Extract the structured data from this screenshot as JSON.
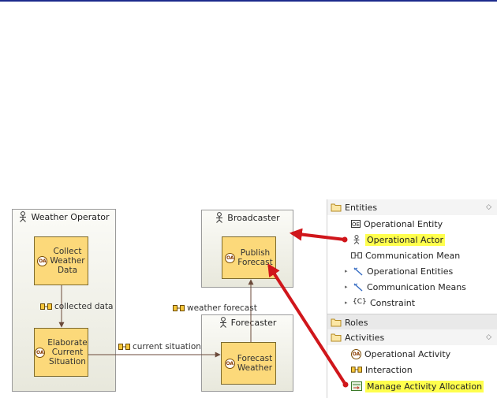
{
  "diagram": {
    "actors": [
      {
        "label": "Weather Operator"
      },
      {
        "label": "Broadcaster"
      },
      {
        "label": "Forecaster"
      }
    ],
    "activities": [
      {
        "label": "Collect Weather Data",
        "line1": "Collect",
        "line2": "Weather",
        "line3": "Data"
      },
      {
        "label": "Elaborate Current Situation",
        "line1": "Elaborate",
        "line2": "Current",
        "line3": "Situation"
      },
      {
        "label": "Publish Forecast",
        "line1": "Publish",
        "line2": "Forecast"
      },
      {
        "label": "Forecast Weather",
        "line1": "Forecast",
        "line2": "Weather"
      }
    ],
    "oa_badge": "OA",
    "interactions": [
      {
        "label": "collected data"
      },
      {
        "label": "current situation"
      },
      {
        "label": "weather forecast"
      }
    ]
  },
  "palette": {
    "entities_header": "Entities",
    "items": [
      {
        "label": "Operational Entity",
        "icon": "operational-entity-icon"
      },
      {
        "label": "Operational Actor",
        "icon": "operational-actor-icon",
        "highlighted": true
      },
      {
        "label": "Communication Mean",
        "icon": "communication-mean-icon"
      },
      {
        "label": "Operational Entities",
        "icon": "operational-entities-icon"
      },
      {
        "label": "Communication Means",
        "icon": "communication-means-icon"
      },
      {
        "label": "Constraint",
        "icon": "constraint-icon"
      }
    ],
    "roles_header": "Roles",
    "activities_header": "Activities",
    "activity_items": [
      {
        "label": "Operational Activity",
        "icon": "operational-activity-icon"
      },
      {
        "label": "Interaction",
        "icon": "interaction-icon"
      },
      {
        "label": "Manage Activity Allocation",
        "icon": "manage-activity-allocation-icon",
        "highlighted": true
      }
    ],
    "collapse_glyph": "◇",
    "constraint_glyph": "{C}",
    "operational_entity_glyph": "OE"
  },
  "colors": {
    "activity_fill": "#fcd97a",
    "highlight": "#ffff4d",
    "arrow_red": "#d0161b"
  }
}
